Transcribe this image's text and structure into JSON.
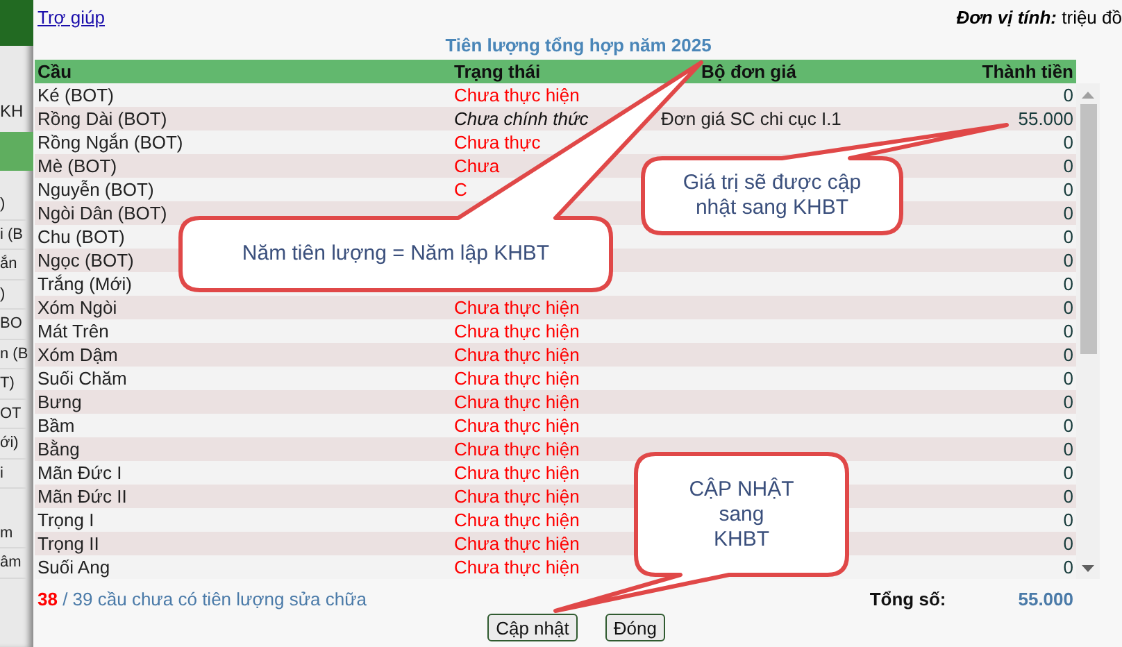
{
  "background_window": {
    "label": "KH",
    "fragments": [
      ")",
      "i (B",
      "ắn",
      ")",
      "BO",
      "n (B",
      "T)",
      "OT",
      "ới)",
      "i",
      "m",
      "âm"
    ]
  },
  "help_link": "Trợ giúp",
  "unit": {
    "label": "Đơn vị tính:",
    "value": "triệu đồ"
  },
  "title": "Tiên lượng tổng hợp năm 2025",
  "table": {
    "columns": [
      "Cầu",
      "Trạng thái",
      "Bộ đơn giá",
      "Thành tiền"
    ],
    "rows": [
      {
        "bridge": "Ké (BOT)",
        "status": "Chưa thực hiện",
        "kind": "pending",
        "amount": "0"
      },
      {
        "bridge": "Rồng Dài (BOT)",
        "status": "Chưa chính thức",
        "kind": "draft",
        "price_set": "Đơn giá SC chi cục I.1",
        "amount": "55.000"
      },
      {
        "bridge": "Rồng Ngắn (BOT)",
        "status": "Chưa thực",
        "kind": "pending",
        "amount": "0"
      },
      {
        "bridge": "Mè (BOT)",
        "status": "Chưa",
        "kind": "pending",
        "amount": "0"
      },
      {
        "bridge": "Nguyễn (BOT)",
        "status": "C",
        "kind": "pending",
        "amount": "0"
      },
      {
        "bridge": "Ngòi Dân (BOT)",
        "amount": "0"
      },
      {
        "bridge": "Chu (BOT)",
        "amount": "0"
      },
      {
        "bridge": "Ngọc (BOT)",
        "amount": "0"
      },
      {
        "bridge": "Trắng (Mới)",
        "amount": "0"
      },
      {
        "bridge": "Xóm Ngòi",
        "status": "Chưa thực hiện",
        "kind": "pending",
        "amount": "0"
      },
      {
        "bridge": "Mát Trên",
        "status": "Chưa thực hiện",
        "kind": "pending",
        "amount": "0"
      },
      {
        "bridge": "Xóm Dậm",
        "status": "Chưa thực hiện",
        "kind": "pending",
        "amount": "0"
      },
      {
        "bridge": "Suối Chăm",
        "status": "Chưa thực hiện",
        "kind": "pending",
        "amount": "0"
      },
      {
        "bridge": "Bưng",
        "status": "Chưa thực hiện",
        "kind": "pending",
        "amount": "0"
      },
      {
        "bridge": "Bầm",
        "status": "Chưa thực hiện",
        "kind": "pending",
        "amount": "0"
      },
      {
        "bridge": "Bằng",
        "status": "Chưa thực hiện",
        "kind": "pending",
        "amount": "0"
      },
      {
        "bridge": "Mãn Đức I",
        "status": "Chưa thực hiện",
        "kind": "pending",
        "amount": "0"
      },
      {
        "bridge": "Mãn Đức II",
        "status": "Chưa thực hiện",
        "kind": "pending",
        "amount": "0"
      },
      {
        "bridge": "Trọng I",
        "status": "Chưa thực hiện",
        "kind": "pending",
        "amount": "0"
      },
      {
        "bridge": "Trọng II",
        "status": "Chưa thực hiện",
        "kind": "pending",
        "amount": "0"
      },
      {
        "bridge": "Suối Ang",
        "status": "Chưa thực hiện",
        "kind": "pending",
        "amount": "0"
      }
    ]
  },
  "summary": "**38** / 39 cầu chưa có tiên lượng sửa chữa",
  "total": {
    "label": "Tổng số:",
    "value": "55.000"
  },
  "buttons": [
    "Cập nhật",
    "Đóng"
  ],
  "callouts": [
    {
      "lines": [
        "Năm tiên lượng = Năm lập KHBT"
      ]
    },
    {
      "lines": [
        "Giá trị sẽ được cập",
        "nhật sang KHBT"
      ]
    },
    {
      "lines": [
        "CẬP NHẬT",
        "sang",
        "KHBT"
      ]
    }
  ]
}
